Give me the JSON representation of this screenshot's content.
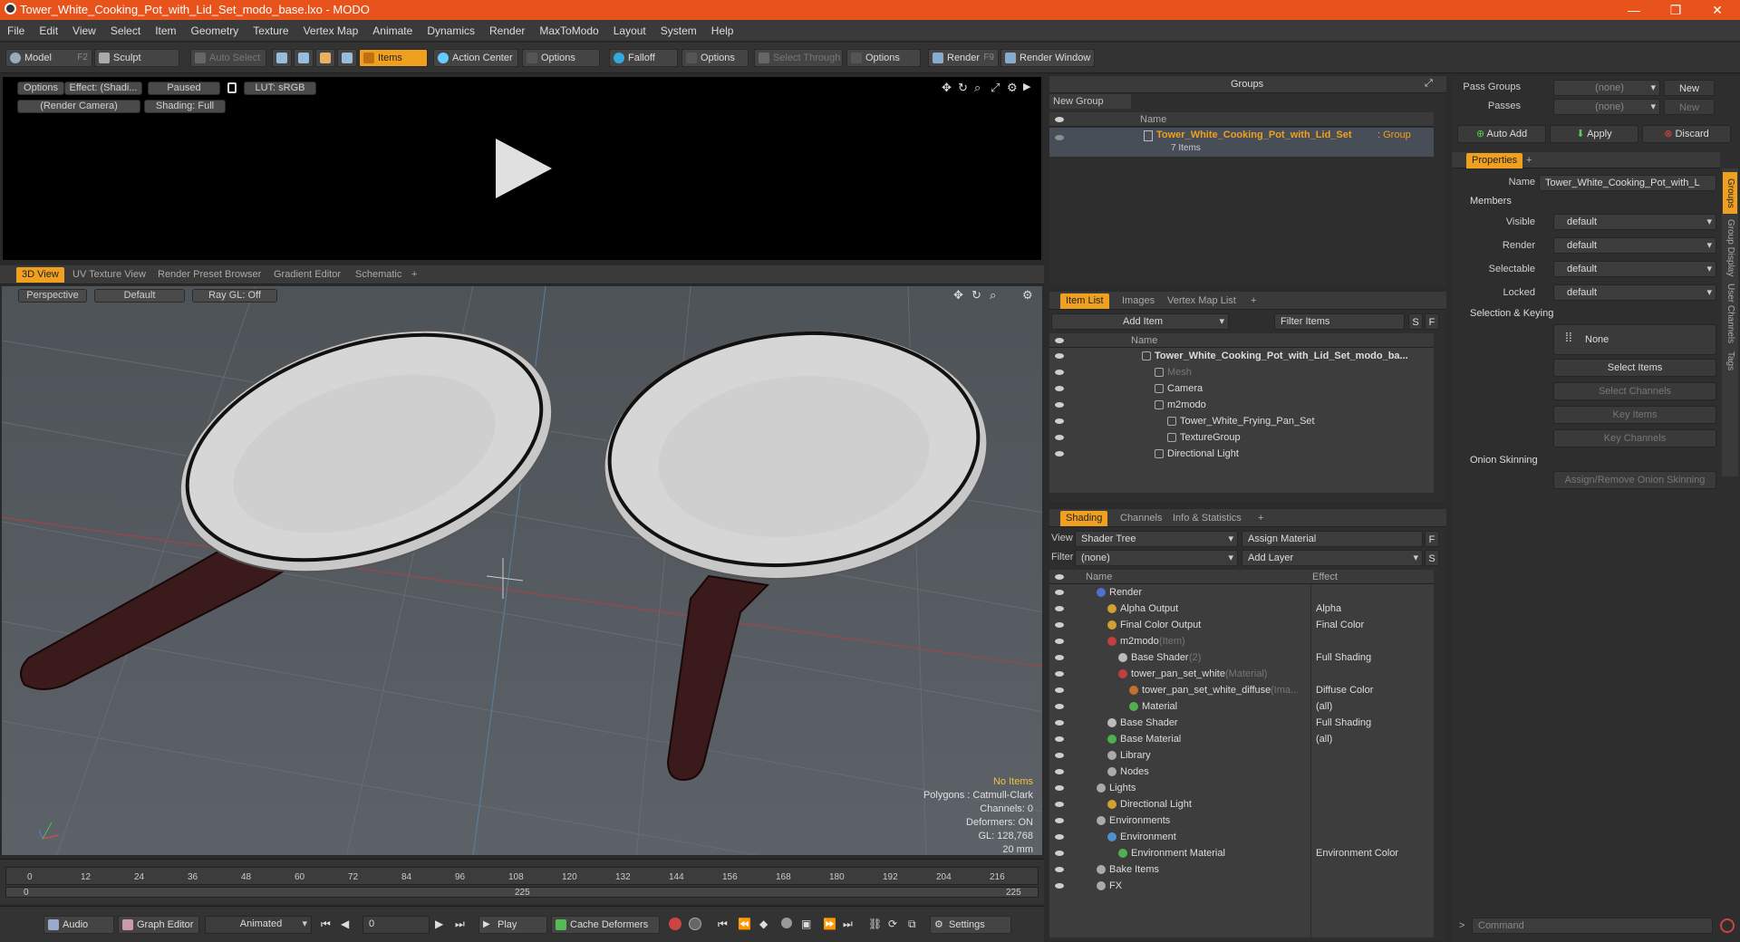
{
  "window": {
    "title": "Tower_White_Cooking_Pot_with_Lid_Set_modo_base.lxo - MODO",
    "minimize": "—",
    "maximize": "❐",
    "close": "✕"
  },
  "menu": [
    "File",
    "Edit",
    "View",
    "Select",
    "Item",
    "Geometry",
    "Texture",
    "Vertex Map",
    "Animate",
    "Dynamics",
    "Render",
    "MaxToModo",
    "Layout",
    "System",
    "Help"
  ],
  "toolbar": {
    "model": "Model",
    "model_key": "F2",
    "sculpt": "Sculpt",
    "auto_select": "Auto Select",
    "items": "Items",
    "action_center": "Action Center",
    "options1": "Options",
    "falloff": "Falloff",
    "options2": "Options",
    "select_through": "Select Through",
    "options3": "Options",
    "render": "Render",
    "render_key": "F9",
    "render_window": "Render Window"
  },
  "preview": {
    "options": "Options",
    "effect": "Effect: (Shadi...",
    "paused": "Paused",
    "lut": "LUT: sRGB",
    "camera": "(Render Camera)",
    "shading": "Shading: Full"
  },
  "viewport_tabs": [
    "3D View",
    "UV Texture View",
    "Render Preset Browser",
    "Gradient Editor",
    "Schematic"
  ],
  "viewport": {
    "perspective": "Perspective",
    "default": "Default",
    "raygl": "Ray GL: Off",
    "stats": {
      "no_items": "No Items",
      "polygons": "Polygons : Catmull-Clark",
      "channels": "Channels: 0",
      "deformers": "Deformers: ON",
      "gl": "GL: 128,768",
      "scale": "20 mm"
    }
  },
  "timeline": {
    "ticks": [
      "0",
      "12",
      "24",
      "36",
      "48",
      "60",
      "72",
      "84",
      "96",
      "108",
      "120",
      "132",
      "144",
      "156",
      "168",
      "180",
      "192",
      "204",
      "216"
    ],
    "sub_start": "0",
    "sub_mid": "225",
    "sub_end": "225"
  },
  "bottombar": {
    "audio": "Audio",
    "graph_editor": "Graph Editor",
    "animated": "Animated",
    "frame": "0",
    "play": "Play",
    "cache_deformers": "Cache Deformers",
    "settings": "Settings"
  },
  "groups": {
    "title": "Groups",
    "new_group": "New Group",
    "col_name": "Name",
    "item_name": "Tower_White_Cooking_Pot_with_Lid_Set",
    "item_type": " : Group",
    "item_count": "7 Items"
  },
  "item_list": {
    "tabs": [
      "Item List",
      "Images",
      "Vertex Map List"
    ],
    "add_item": "Add Item",
    "filter": "Filter Items",
    "s": "S",
    "f": "F",
    "col_name": "Name",
    "rows": [
      {
        "name": "Tower_White_Cooking_Pot_with_Lid_Set_modo_ba...",
        "indent": 0,
        "bold": true
      },
      {
        "name": "Mesh",
        "indent": 1,
        "dim": true
      },
      {
        "name": "Camera",
        "indent": 1
      },
      {
        "name": "m2modo",
        "indent": 1
      },
      {
        "name": "Tower_White_Frying_Pan_Set",
        "indent": 2
      },
      {
        "name": "TextureGroup",
        "indent": 2
      },
      {
        "name": "Directional Light",
        "indent": 1
      }
    ]
  },
  "shading": {
    "tabs": [
      "Shading",
      "Channels",
      "Info & Statistics"
    ],
    "view_label": "View",
    "view_value": "Shader Tree",
    "assign_material": "Assign Material",
    "filter_label": "Filter",
    "filter_value": "(none)",
    "add_layer": "Add Layer",
    "f": "F",
    "s": "S",
    "col_name": "Name",
    "col_effect": "Effect",
    "rows": [
      {
        "name": "Render",
        "effect": "",
        "indent": 0
      },
      {
        "name": "Alpha Output",
        "effect": "Alpha",
        "indent": 1
      },
      {
        "name": "Final Color Output",
        "effect": "Final Color",
        "indent": 1
      },
      {
        "name": "m2modo",
        "suffix": " (Item)",
        "effect": "",
        "indent": 1
      },
      {
        "name": "Base Shader",
        "suffix": " (2)",
        "effect": "Full Shading",
        "indent": 2
      },
      {
        "name": "tower_pan_set_white",
        "suffix": " (Material)",
        "effect": "",
        "indent": 2
      },
      {
        "name": "tower_pan_set_white_diffuse",
        "suffix": " (Ima...",
        "effect": "Diffuse Color",
        "indent": 3
      },
      {
        "name": "Material",
        "effect": "(all)",
        "indent": 3
      },
      {
        "name": "Base Shader",
        "effect": "Full Shading",
        "indent": 1
      },
      {
        "name": "Base Material",
        "effect": "(all)",
        "indent": 1
      },
      {
        "name": "Library",
        "effect": "",
        "indent": 1
      },
      {
        "name": "Nodes",
        "effect": "",
        "indent": 1
      },
      {
        "name": "Lights",
        "effect": "",
        "indent": 0
      },
      {
        "name": "Directional Light",
        "effect": "",
        "indent": 1
      },
      {
        "name": "Environments",
        "effect": "",
        "indent": 0
      },
      {
        "name": "Environment",
        "effect": "",
        "indent": 1
      },
      {
        "name": "Environment Material",
        "effect": "Environment Color",
        "indent": 2
      },
      {
        "name": "Bake Items",
        "effect": "",
        "indent": 0
      },
      {
        "name": "FX",
        "effect": "",
        "indent": 0
      }
    ]
  },
  "properties": {
    "pass_groups": "Pass Groups",
    "pass_groups_val": "(none)",
    "new1": "New",
    "passes": "Passes",
    "passes_val": "(none)",
    "new2": "New",
    "auto_add": "Auto Add",
    "apply": "Apply",
    "discard": "Discard",
    "tab": "Properties",
    "name_label": "Name",
    "name_value": "Tower_White_Cooking_Pot_with_L",
    "members": "Members",
    "visible": "Visible",
    "render": "Render",
    "selectable": "Selectable",
    "locked": "Locked",
    "default": "default",
    "selection_keying": "Selection & Keying",
    "none": "None",
    "select_items": "Select Items",
    "select_channels": "Select Channels",
    "key_items": "Key Items",
    "key_channels": "Key Channels",
    "onion": "Onion Skinning",
    "assign_onion": "Assign/Remove Onion Skinning",
    "side_tabs": [
      "Groups",
      "Group Display",
      "User Channels",
      "Tags"
    ],
    "command": "Command"
  }
}
